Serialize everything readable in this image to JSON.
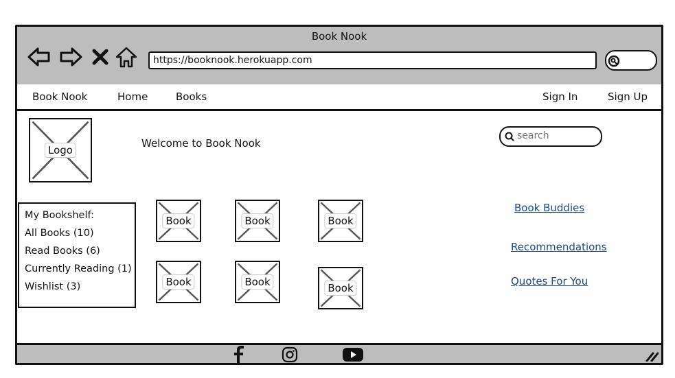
{
  "window": {
    "title": "Book Nook"
  },
  "browser": {
    "back_icon": "back-arrow-icon",
    "forward_icon": "forward-arrow-icon",
    "stop_icon": "close-icon",
    "home_icon": "home-icon",
    "url": "https://booknook.herokuapp.com",
    "search_icon": "search-icon"
  },
  "navbar": {
    "brand": "Book Nook",
    "home": "Home",
    "books": "Books",
    "sign_in": "Sign In",
    "sign_up": "Sign Up"
  },
  "header": {
    "logo_label": "Logo",
    "welcome": "Welcome to Book Nook",
    "search_placeholder": "search"
  },
  "bookshelf": {
    "title": "My Bookshelf:",
    "items": [
      "All Books (10)",
      "Read Books (6)",
      "Currently Reading (1)",
      "Wishlist (3)"
    ]
  },
  "books": [
    "Book",
    "Book",
    "Book",
    "Book",
    "Book",
    "Book"
  ],
  "side_links": [
    "Book Buddies",
    "Recommendations",
    "Quotes For You"
  ],
  "footer": {
    "icons": [
      "facebook-icon",
      "instagram-icon",
      "youtube-icon"
    ]
  },
  "colors": {
    "chrome": "#bdbdbd",
    "link": "#1a4b8a",
    "border": "#111111"
  }
}
